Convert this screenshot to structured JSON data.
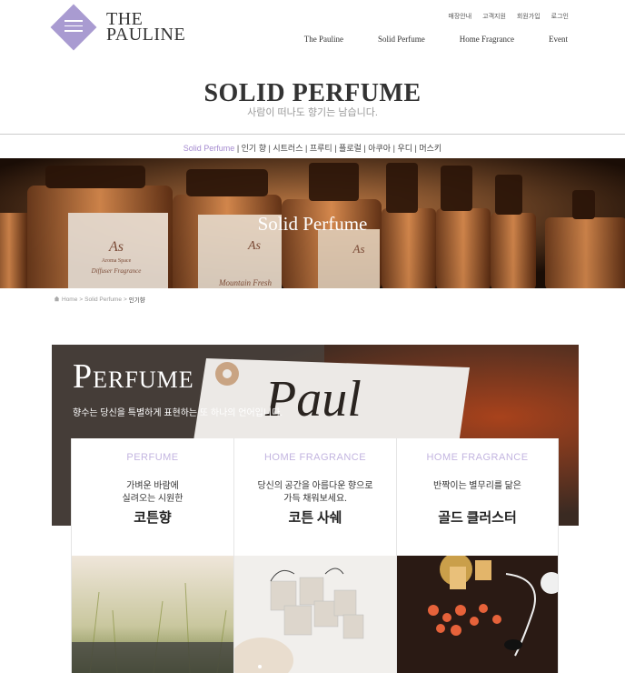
{
  "header": {
    "logo_line1": "THE",
    "logo_line2": "PAULINE",
    "util_links": [
      "매장안내",
      "고객지원",
      "회원가입",
      "로그인"
    ],
    "nav": [
      "The Pauline",
      "Solid Perfume",
      "Home Fragrance",
      "Event"
    ]
  },
  "page": {
    "title": "SOLID PERFUME",
    "subtitle": "사람이 떠나도 향기는 남습니다."
  },
  "subnav": {
    "active": "Solid Perfume",
    "items": [
      "인기 향",
      "시트러스",
      "프루티",
      "플로럴",
      "아쿠아",
      "우디",
      "머스키"
    ]
  },
  "banner": {
    "title": "Solid Perfume",
    "bottle_label1": "Aroma Space",
    "bottle_label2": "Diffuser Fragrance",
    "bottle_label3": "Mountain Fresh"
  },
  "breadcrumb": {
    "home": "Home",
    "section": "Solid Perfume",
    "current": "인기향"
  },
  "perfume": {
    "title_first": "P",
    "title_rest": "ERFUME",
    "description": "향수는 당신을 특별하게 표현하는 또 하나의 언어입니다.",
    "tag_text": "Paul"
  },
  "cards": [
    {
      "category": "PERFUME",
      "desc_line1": "가벼운 바람에",
      "desc_line2": "실려오는 시원한",
      "name": "코튼향"
    },
    {
      "category": "HOME FRAGRANCE",
      "desc_line1": "당신의 공간을 아름다운 향으로",
      "desc_line2": "가득 채워보세요.",
      "name": "코튼 사쉐"
    },
    {
      "category": "HOME FRAGRANCE",
      "desc_line1": "반짝이는 별무리를 닮은",
      "desc_line2": "",
      "name": "골드 클러스터"
    }
  ],
  "colors": {
    "accent": "#a99bd1",
    "subnav_active": "#a58bd0",
    "card_category": "#c3b5e0"
  }
}
